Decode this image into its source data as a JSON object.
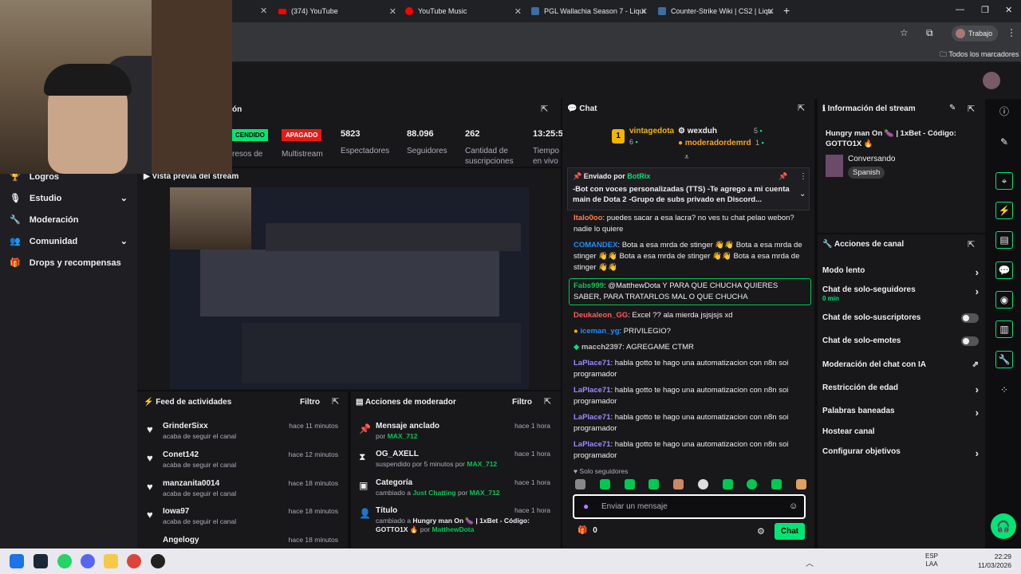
{
  "browser": {
    "tabs": [
      {
        "label": "(374) YouTube"
      },
      {
        "label": "YouTube Music"
      },
      {
        "label": "PGL Wallachia Season 7 - Liqui"
      },
      {
        "label": "Counter-Strike Wiki | CS2 | Liqu"
      }
    ],
    "profile": "Trabajo",
    "bookmarks_label": "Todos los marcadores"
  },
  "stats": {
    "status_on": "ENCENDIDO",
    "status_on_tail": "CENDIDO",
    "multistream_badge": "APAGADO",
    "multistream_label": "Multistream",
    "viewers": "5823",
    "viewers_label": "Espectadores",
    "followers": "88.096",
    "followers_label": "Seguidores",
    "subs": "262",
    "subs_label": "Cantidad de suscripciones",
    "time": "13:25:5",
    "time_label": "Tiempo en vivo",
    "left_label": "resos de",
    "left_title": "ón"
  },
  "nav": {
    "items": [
      {
        "label": "Logros"
      },
      {
        "label": "Estudio"
      },
      {
        "label": "Moderación"
      },
      {
        "label": "Comunidad"
      },
      {
        "label": "Drops y recompensas"
      }
    ]
  },
  "preview": {
    "title": "Vista previa del stream"
  },
  "feed": {
    "title": "Feed de actividades",
    "filter": "Filtro",
    "rows": [
      {
        "name": "GrinderSixx",
        "sub": "acaba de seguir el canal",
        "time": "hace 11 minutos"
      },
      {
        "name": "Conet142",
        "sub": "acaba de seguir el canal",
        "time": "hace 12 minutos"
      },
      {
        "name": "manzanita0014",
        "sub": "acaba de seguir el canal",
        "time": "hace 18 minutos"
      },
      {
        "name": "Iowa97",
        "sub": "acaba de seguir el canal",
        "time": "hace 18 minutos"
      },
      {
        "name": "Angelogy",
        "sub": "",
        "time": "hace 18 minutos"
      }
    ]
  },
  "modactions": {
    "title": "Acciones de moderador",
    "filter": "Filtro",
    "rows": [
      {
        "title": "Mensaje anclado",
        "pre": "por ",
        "user": "MAX_712",
        "mid": "",
        "user2": "",
        "time": "hace 1 hora"
      },
      {
        "title": "OG_AXELL",
        "pre": "suspendido por 5 minutos por ",
        "user": "MAX_712",
        "mid": "",
        "user2": "",
        "time": "hace 1 hora"
      },
      {
        "title": "Categoría",
        "pre": "cambiado a ",
        "user": "Just Chatting",
        "mid": " por ",
        "user2": "MAX_712",
        "time": "hace 1 hora"
      },
      {
        "title": "Título",
        "pre": "cambiado a ",
        "user": "Hungry man On 🍆 | 1xBet - Código: GOTTO1X 🔥",
        "mid": " por ",
        "user2": "MatthewDota",
        "time": "hace 1 hora"
      }
    ]
  },
  "chat": {
    "title": "Chat",
    "top": [
      {
        "name": "vintagedota",
        "count": "6"
      },
      {
        "name": "wexduh",
        "count": "5"
      },
      {
        "name": "moderadordemrd",
        "count": "1"
      }
    ],
    "pinned_by": "Enviado por",
    "pinned_user": "BotRix",
    "pinned_text": "-Bot con voces personalizadas (TTS) -Te agrego a mi cuenta main de Dota 2 -Grupo de subs privado en Discord...",
    "messages": [
      {
        "user": "Italo0oo",
        "color": "#ff7f50",
        "text": ": puedes sacar a esa lacra? no ves tu chat pelao webon? nadie lo quiere"
      },
      {
        "user": "COMANDEX",
        "color": "#1e90ff",
        "text": ": Bota a esa mrda de stinger 👋👋 Bota a esa mrda de stinger 👋👋 Bota a esa mrda de stinger 👋👋 Bota a esa mrda de stinger 👋👋"
      },
      {
        "user": "Fabs999",
        "color": "#00c853",
        "text": ": @MatthewDota Y PARA QUE CHUCHA QUIERES SABER, PARA TRATARLOS MAL O QUE CHUCHA"
      },
      {
        "user": "Deukaleon_GG",
        "color": "#ff5c5c",
        "text": ": Excel ?? ala mierda jsjsjsjs xd"
      },
      {
        "user": "iceman_yg",
        "color": "#1e90ff",
        "text": ": PRIVILEGIO?"
      },
      {
        "user": "macch2397",
        "color": "#c0c0c0",
        "text": ": AGREGAME CTMR"
      },
      {
        "user": "LaPlace71",
        "color": "#9b8cff",
        "text": ": habla gotto te hago una automatizacion con n8n soi programador"
      },
      {
        "user": "LaPlace71",
        "color": "#9b8cff",
        "text": ": habla gotto te hago una automatizacion con n8n soi programador"
      },
      {
        "user": "LaPlace71",
        "color": "#9b8cff",
        "text": ": habla gotto te hago una automatizacion con n8n soi programador"
      },
      {
        "user": "LaPlace71",
        "color": "#9b8cff",
        "text": ": habla gotto te hago una automatizacion con n8n soi programador"
      }
    ],
    "followers_only": "Solo seguidores",
    "input_placeholder": "Enviar un mensaje",
    "points": "0",
    "send": "Chat"
  },
  "info": {
    "title": "Información del stream",
    "stream_title": "Hungry man On 🍆 | 1xBet - Código: GOTTO1X 🔥",
    "category": "Conversando",
    "language": "Spanish"
  },
  "actions": {
    "title": "Acciones de canal",
    "items": [
      {
        "label": "Modo lento"
      },
      {
        "label": "Chat de solo-seguidores",
        "sub": "0 min"
      },
      {
        "label": "Chat de solo-suscriptores"
      },
      {
        "label": "Chat de solo-emotes"
      },
      {
        "label": "Moderación del chat con IA"
      },
      {
        "label": "Restricción de edad"
      },
      {
        "label": "Palabras baneadas"
      },
      {
        "label": "Hostear canal"
      },
      {
        "label": "Configurar objetivos"
      }
    ]
  },
  "taskbar": {
    "lang": "ESP",
    "lang2": "LAA",
    "time": "22:29",
    "date": "11/03/2026"
  }
}
